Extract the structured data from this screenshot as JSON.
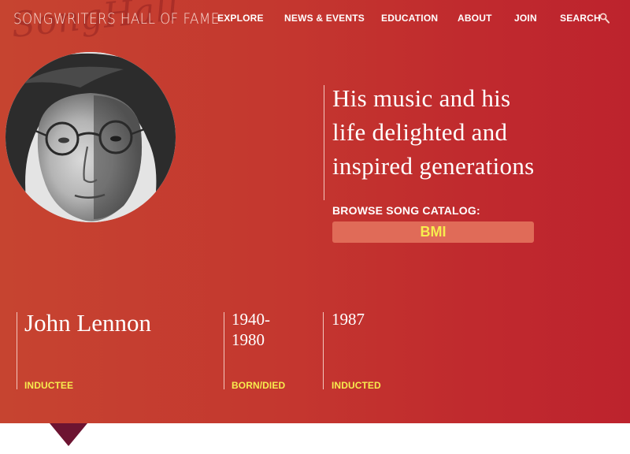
{
  "site": {
    "logo_text": "Songwriters Hall of Fame",
    "logo_script": "SongHall"
  },
  "nav": {
    "items": [
      {
        "label": "EXPLORE"
      },
      {
        "label": "NEWS & EVENTS"
      },
      {
        "label": "EDUCATION"
      },
      {
        "label": "ABOUT"
      },
      {
        "label": "JOIN"
      },
      {
        "label": "SEARCH"
      }
    ],
    "search_icon": "magnifier-icon"
  },
  "hero": {
    "portrait_alt": "John Lennon",
    "quote_lines": [
      "His music and his",
      "life delighted and",
      "inspired generations"
    ],
    "catalog_label": "BROWSE SONG CATALOG:",
    "catalog_button": "BMI"
  },
  "facts": {
    "name": "John Lennon",
    "name_label": "INDUCTEE",
    "born_died_line1": "1940-",
    "born_died_line2": "1980",
    "born_died_label": "BORN/DIED",
    "inducted_year": "1987",
    "inducted_label": "INDUCTED"
  },
  "colors": {
    "hero_start": "#c64430",
    "hero_end": "#bd232d",
    "accent_yellow": "#f7ec4e",
    "button_bg": "#e06b58",
    "marker": "#6d1431"
  }
}
